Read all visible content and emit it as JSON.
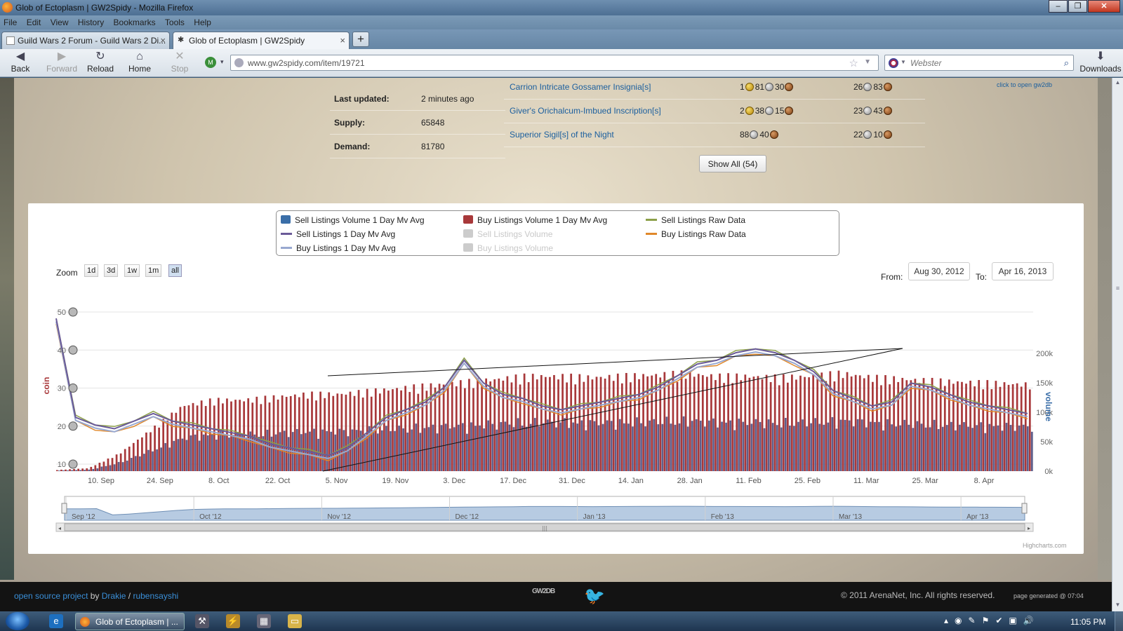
{
  "window": {
    "title": "Glob of Ectoplasm | GW2Spidy - Mozilla Firefox"
  },
  "menu": [
    "File",
    "Edit",
    "View",
    "History",
    "Bookmarks",
    "Tools",
    "Help"
  ],
  "tabs": [
    {
      "label": "Guild Wars 2 Forum - Guild Wars 2 Di...",
      "active": false
    },
    {
      "label": "Glob of Ectoplasm | GW2Spidy",
      "active": true
    }
  ],
  "nav": {
    "back": "Back",
    "forward": "Forward",
    "reload": "Reload",
    "home": "Home",
    "stop": "Stop",
    "downloads": "Downloads"
  },
  "url": "www.gw2spidy.com/item/19721",
  "search": {
    "engine": "Webster",
    "placeholder": "Webster"
  },
  "item_info": [
    {
      "label": "Last updated:",
      "value": "2 minutes ago"
    },
    {
      "label": "Supply:",
      "value": "65848"
    },
    {
      "label": "Demand:",
      "value": "81780"
    }
  ],
  "recipes": [
    {
      "name": "Carrion Intricate Gossamer Insignia[s]",
      "p1": {
        "g": "1",
        "s": "81",
        "c": "30"
      },
      "p2": {
        "s": "26",
        "c": "83"
      }
    },
    {
      "name": "Giver's Orichalcum-Imbued Inscription[s]",
      "p1": {
        "g": "2",
        "s": "38",
        "c": "15"
      },
      "p2": {
        "s": "23",
        "c": "43"
      }
    },
    {
      "name": "Superior Sigil[s] of the Night",
      "p1": {
        "s": "88",
        "c": "40"
      },
      "p2": {
        "s": "22",
        "c": "10"
      }
    }
  ],
  "gw2db_link": "click to open gw2db",
  "show_all": "Show All (54)",
  "chart_ui": {
    "zoom_label": "Zoom",
    "zoom_buttons": [
      "1d",
      "3d",
      "1w",
      "1m",
      "all"
    ],
    "selected_zoom": "all",
    "from_label": "From:",
    "to_label": "To:",
    "from": "Aug 30, 2012",
    "to": "Apr 16, 2013",
    "credit": "Highcharts.com",
    "y_left_title": "coin",
    "y_right_title": "volume"
  },
  "legend": [
    {
      "name": "Sell Listings Volume 1 Day Mv Avg",
      "color": "#3a6ea8",
      "type": "swatch",
      "enabled": true
    },
    {
      "name": "Buy Listings Volume 1 Day Mv Avg",
      "color": "#a8383a",
      "type": "swatch",
      "enabled": true
    },
    {
      "name": "Sell Listings Raw Data",
      "color": "#8ca048",
      "type": "line",
      "enabled": true
    },
    {
      "name": "Sell Listings 1 Day Mv Avg",
      "color": "#6a5a98",
      "type": "line",
      "enabled": true
    },
    {
      "name": "Sell Listings Volume",
      "color": "#cccccc",
      "type": "swatch",
      "enabled": false
    },
    {
      "name": "Buy Listings Raw Data",
      "color": "#e0882a",
      "type": "line",
      "enabled": true
    },
    {
      "name": "Buy Listings 1 Day Mv Avg",
      "color": "#98a8d0",
      "type": "line",
      "enabled": true
    },
    {
      "name": "Buy Listings Volume",
      "color": "#cccccc",
      "type": "swatch",
      "enabled": false
    }
  ],
  "chart_data": {
    "type": "line",
    "x_ticks": [
      "10. Sep",
      "24. Sep",
      "8. Oct",
      "22. Oct",
      "5. Nov",
      "19. Nov",
      "3. Dec",
      "17. Dec",
      "31. Dec",
      "14. Jan",
      "28. Jan",
      "11. Feb",
      "25. Feb",
      "11. Mar",
      "25. Mar",
      "8. Apr"
    ],
    "y_left_ticks": [
      "10",
      "20",
      "30",
      "40",
      "50"
    ],
    "y_left_range": [
      10,
      50
    ],
    "y_right_ticks": [
      "0k",
      "50k",
      "100k",
      "150k",
      "200k"
    ],
    "y_right_range": [
      0,
      250000
    ],
    "navigator_labels": [
      "Sep '12",
      "Oct '12",
      "Nov '12",
      "Dec '12",
      "Jan '13",
      "Feb '13",
      "Mar '13",
      "Apr '13"
    ],
    "price_series_approx": [
      48,
      22,
      20,
      19,
      21,
      23,
      21,
      20,
      19,
      18,
      17,
      15,
      14,
      13,
      12,
      14,
      18,
      22,
      24,
      26,
      30,
      37,
      31,
      28,
      27,
      25,
      24,
      25,
      26,
      27,
      28,
      30,
      33,
      36,
      37,
      39,
      40,
      39,
      37,
      34,
      29,
      27,
      25,
      26,
      31,
      30,
      28,
      26,
      25,
      24,
      23
    ],
    "volume_series_approx": [
      2000,
      5000,
      30000,
      70000,
      110000,
      120000,
      120000,
      125000,
      130000,
      130000,
      135000,
      140000,
      145000,
      150000,
      155000,
      160000,
      160000,
      158000,
      160000,
      162000,
      165000,
      160000,
      160000,
      158000,
      160000,
      165000,
      158000,
      155000,
      152000,
      150000,
      148000,
      146000
    ]
  },
  "footer": {
    "src_text_a": "open source project",
    "src_text_b": " by ",
    "src_author1": "Drakie",
    "src_sep": " / ",
    "src_author2": "rubensayshi",
    "logo": "GW2DB",
    "copyright": "© 2011 ArenaNet, Inc. All rights reserved.",
    "generated": "page generated @ 07:04"
  },
  "taskbar": {
    "item": "Glob of Ectoplasm | ...",
    "clock": "11:05 PM"
  }
}
